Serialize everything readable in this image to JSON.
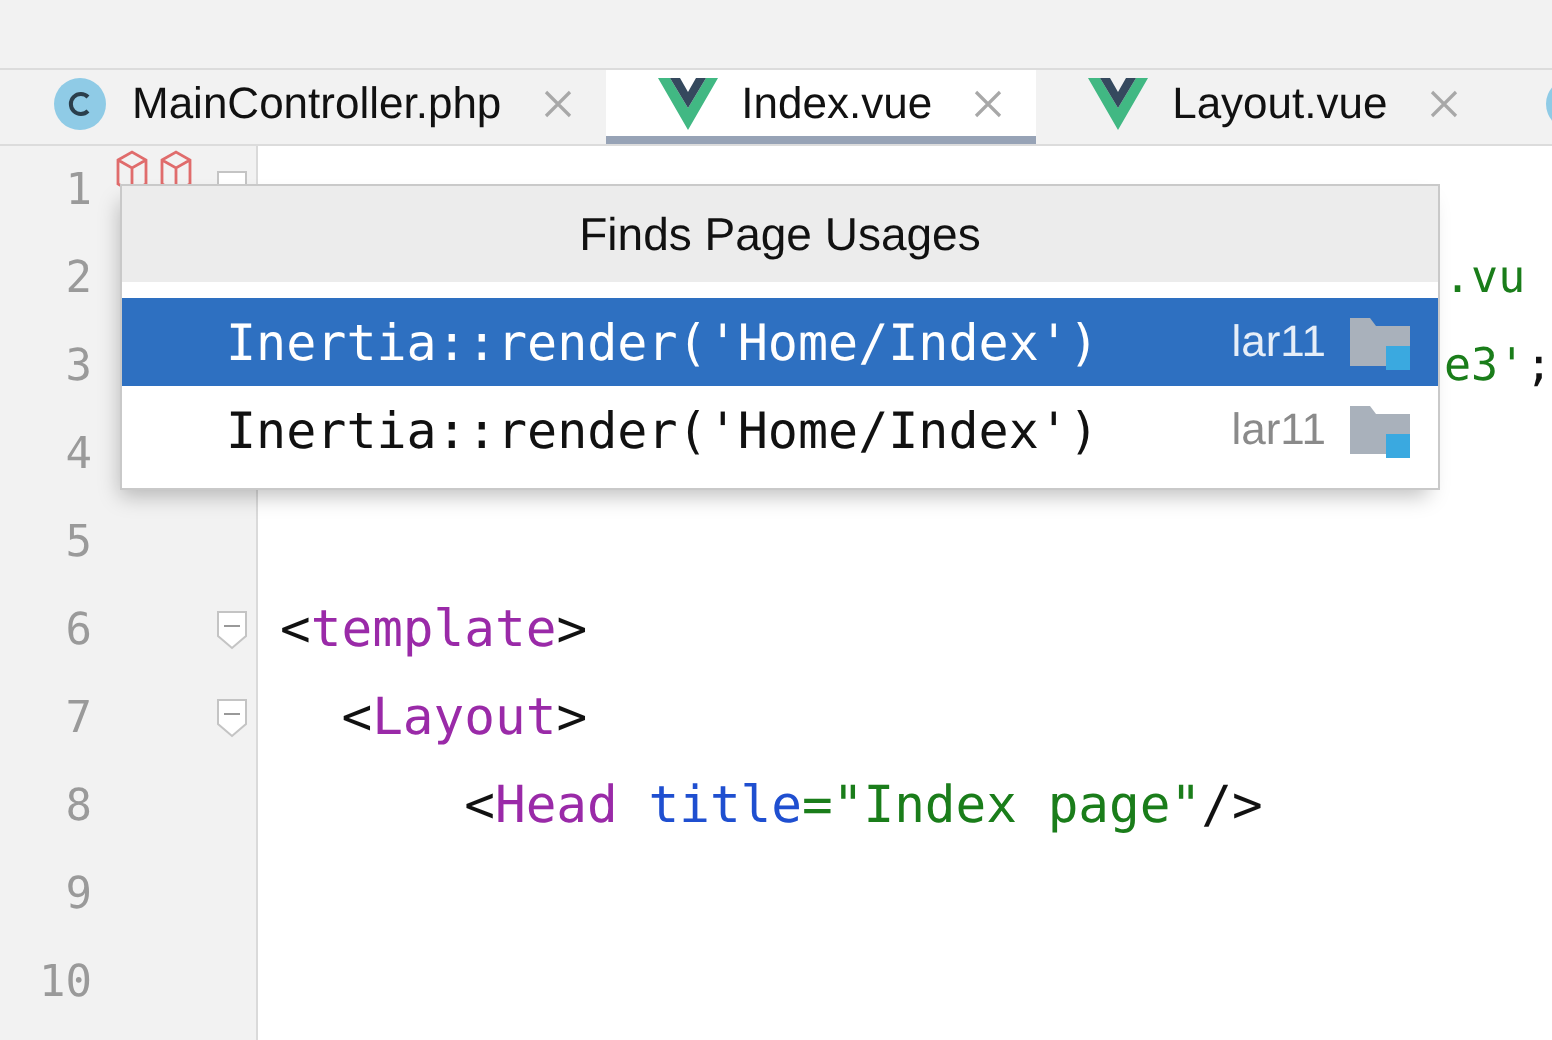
{
  "tabs": [
    {
      "label": "MainController.php",
      "kind": "class",
      "selected": false
    },
    {
      "label": "Index.vue",
      "kind": "vue",
      "selected": true
    },
    {
      "label": "Layout.vue",
      "kind": "vue",
      "selected": false
    },
    {
      "kind": "class",
      "selected": false
    }
  ],
  "editor": {
    "lines": [
      {
        "number": "1",
        "marker": true,
        "fold": true
      },
      {
        "number": "2",
        "clipped": true,
        "tokens": [
          {
            "kind": "string",
            "text": ".vu"
          }
        ]
      },
      {
        "number": "3",
        "clipped": true,
        "tokens": [
          {
            "kind": "string",
            "text": "e3'"
          },
          {
            "kind": "punct",
            "text": ";"
          }
        ]
      },
      {
        "number": "4"
      },
      {
        "number": "5"
      },
      {
        "number": "6",
        "fold": true,
        "tokens": [
          {
            "kind": "punct",
            "text": "<"
          },
          {
            "kind": "tag",
            "text": "template"
          },
          {
            "kind": "punct",
            "text": ">"
          }
        ]
      },
      {
        "number": "7",
        "fold": true,
        "tokens": [
          {
            "kind": "punct",
            "text": "  <"
          },
          {
            "kind": "tag",
            "text": "Layout"
          },
          {
            "kind": "punct",
            "text": ">"
          }
        ]
      },
      {
        "number": "8",
        "tokens": [
          {
            "kind": "punct",
            "text": "      <"
          },
          {
            "kind": "tag",
            "text": "Head"
          },
          {
            "kind": "attr",
            "text": " title"
          },
          {
            "kind": "string",
            "text": "=\"Index page\""
          },
          {
            "kind": "punct",
            "text": "/>"
          }
        ]
      },
      {
        "number": "9"
      },
      {
        "number": "10"
      }
    ]
  },
  "popup": {
    "title": "Finds Page Usages",
    "items": [
      {
        "text": "Inertia::render('Home/Index')",
        "module": "lar11",
        "selected": true
      },
      {
        "text": "Inertia::render('Home/Index')",
        "module": "lar11",
        "selected": false
      }
    ]
  }
}
